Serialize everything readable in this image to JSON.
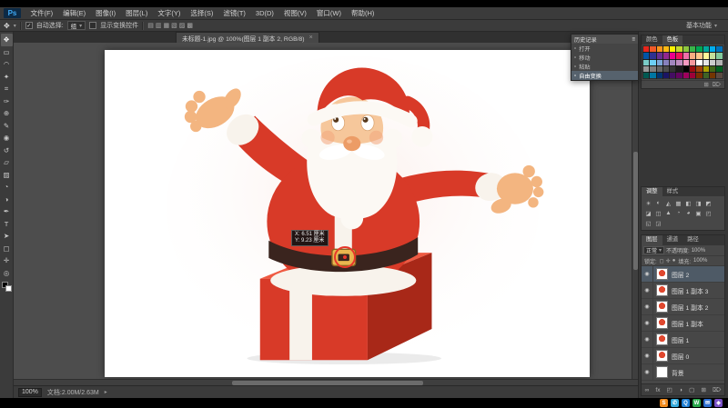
{
  "menu": {
    "logo": "Ps",
    "items": [
      "文件(F)",
      "编辑(E)",
      "图像(I)",
      "图层(L)",
      "文字(Y)",
      "选择(S)",
      "滤镜(T)",
      "3D(D)",
      "视图(V)",
      "窗口(W)",
      "帮助(H)"
    ]
  },
  "options": {
    "auto_select_label": "自动选择:",
    "auto_select_value": "组",
    "show_transform_label": "显示变换控件",
    "align_icons": [
      "▤",
      "▥",
      "▦",
      "▧",
      "▨",
      "▩"
    ],
    "workspace": "基本功能"
  },
  "document_tab": {
    "title": "未标题-1.jpg @ 100%(图层 1 副本 2, RGB/8)",
    "close": "×"
  },
  "tools": [
    {
      "name": "move-tool",
      "icon": "✥"
    },
    {
      "name": "marquee-tool",
      "icon": "▭"
    },
    {
      "name": "lasso-tool",
      "icon": "◠"
    },
    {
      "name": "quick-select-tool",
      "icon": "✦"
    },
    {
      "name": "crop-tool",
      "icon": "⌗"
    },
    {
      "name": "eyedropper-tool",
      "icon": "✑"
    },
    {
      "name": "healing-brush-tool",
      "icon": "⊕"
    },
    {
      "name": "brush-tool",
      "icon": "✎"
    },
    {
      "name": "clone-stamp-tool",
      "icon": "◉"
    },
    {
      "name": "history-brush-tool",
      "icon": "↺"
    },
    {
      "name": "eraser-tool",
      "icon": "▱"
    },
    {
      "name": "gradient-tool",
      "icon": "▨"
    },
    {
      "name": "blur-tool",
      "icon": "◔"
    },
    {
      "name": "dodge-tool",
      "icon": "◑"
    },
    {
      "name": "pen-tool",
      "icon": "✒"
    },
    {
      "name": "type-tool",
      "icon": "T"
    },
    {
      "name": "path-select-tool",
      "icon": "➤"
    },
    {
      "name": "shape-tool",
      "icon": "▢"
    },
    {
      "name": "hand-tool",
      "icon": "✛"
    },
    {
      "name": "zoom-tool",
      "icon": "◎"
    }
  ],
  "canvas_tooltip": {
    "line1": "X: 6.51 厘米",
    "line2": "Y: 9.23 厘米"
  },
  "history_panel": {
    "title": "历史记录",
    "menu_icon": "≡",
    "items": [
      "打开",
      "移动",
      "粘贴",
      "自由变换"
    ],
    "selected_index": 3
  },
  "swatches_panel": {
    "tab1": "颜色",
    "tab2": "色板",
    "footer_icons": [
      "⊞",
      "⌦"
    ],
    "colors": [
      "#e8261c",
      "#f05a28",
      "#f7941d",
      "#fdb913",
      "#fff200",
      "#c4d92e",
      "#8dc63f",
      "#39b54a",
      "#00a651",
      "#00a99d",
      "#00aeef",
      "#0072bc",
      "#0054a6",
      "#2e3192",
      "#662d91",
      "#92278f",
      "#ec008c",
      "#ed145b",
      "#f06eaa",
      "#f9ad81",
      "#fdc689",
      "#fff799",
      "#c4df9b",
      "#82ca9c",
      "#7accc8",
      "#6dcff6",
      "#7da7d9",
      "#8781bd",
      "#a186be",
      "#bd8cbf",
      "#f49ac1",
      "#f5989d",
      "#ffffff",
      "#e6e6e6",
      "#cccccc",
      "#b3b3b3",
      "#999999",
      "#808080",
      "#666666",
      "#4d4d4d",
      "#333333",
      "#1a1a1a",
      "#000000",
      "#9e0b0f",
      "#a0410d",
      "#aba000",
      "#406618",
      "#005e20",
      "#005952",
      "#0076a3",
      "#003471",
      "#1b1464",
      "#440e62",
      "#630460",
      "#9e005d",
      "#9e0039",
      "#7b2e00",
      "#406325",
      "#733500",
      "#5a4a42"
    ]
  },
  "adjustments_panel": {
    "tab1": "调整",
    "tab2": "样式",
    "icons": [
      "☀",
      "◐",
      "◭",
      "▦",
      "◧",
      "◨",
      "◩",
      "◪",
      "◫",
      "▲",
      "◔",
      "◕",
      "▣",
      "◰",
      "◱",
      "◲"
    ]
  },
  "layers_panel": {
    "tab_layers": "图层",
    "tab_channels": "通道",
    "tab_paths": "路径",
    "blend_mode": "正常",
    "opacity_label": "不透明度:",
    "opacity_value": "100%",
    "lock_label": "锁定:",
    "lock_icons": [
      "◻",
      "✛",
      "●"
    ],
    "fill_label": "填充:",
    "fill_value": "100%",
    "rows": [
      {
        "name": "图层 2",
        "thumb": "santa",
        "selected": true
      },
      {
        "name": "图层 1 副本 3",
        "thumb": "santa",
        "selected": false
      },
      {
        "name": "图层 1 副本 2",
        "thumb": "santa",
        "selected": false
      },
      {
        "name": "图层 1 副本",
        "thumb": "santa",
        "selected": false
      },
      {
        "name": "图层 1",
        "thumb": "santa",
        "selected": false
      },
      {
        "name": "图层 0",
        "thumb": "santa",
        "selected": false
      },
      {
        "name": "背景",
        "thumb": "white",
        "selected": false
      }
    ],
    "footer_icons": [
      "∞",
      "fx",
      "◰",
      "◑",
      "▢",
      "⊞",
      "⌦"
    ]
  },
  "status_bar": {
    "zoom": "100%",
    "doc_info": "文档:2.00M/2.63M",
    "arrow": "▸"
  },
  "taskbar": [
    {
      "label": "S",
      "color": "#f08a1d"
    },
    {
      "label": "✆",
      "color": "#35aadc"
    },
    {
      "label": "Q",
      "color": "#1f7fd4"
    },
    {
      "label": "W",
      "color": "#2aa84c"
    },
    {
      "label": "✉",
      "color": "#2e6fd0"
    },
    {
      "label": "◈",
      "color": "#7a52c7"
    }
  ]
}
